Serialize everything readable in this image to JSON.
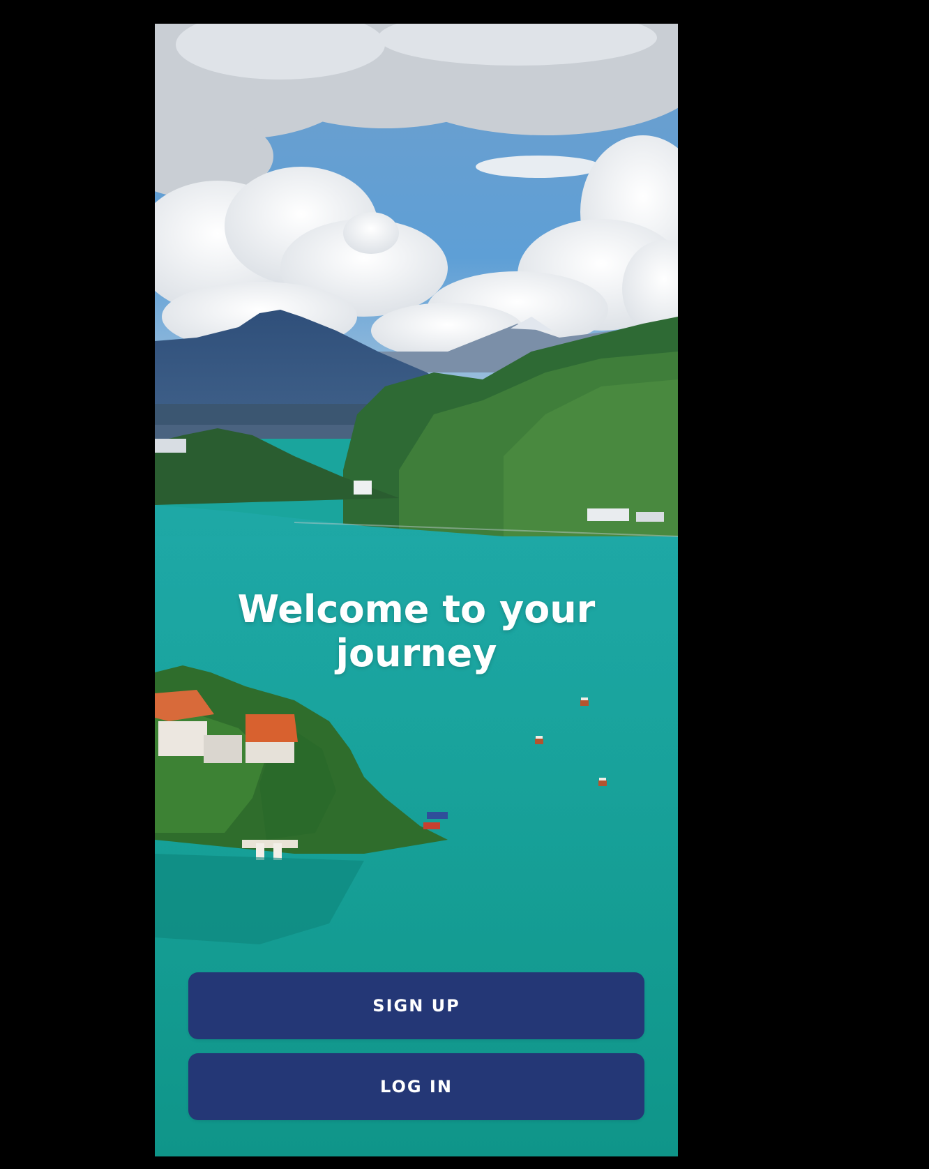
{
  "screen": {
    "title": "Welcome to your journey"
  },
  "actions": {
    "signup_label": "SIGN UP",
    "login_label": "LOG IN"
  },
  "background": {
    "icon": "lake-landscape-photo"
  },
  "colors": {
    "page_background": "#000000",
    "button": "#243776",
    "button_text": "#ffffff",
    "title_text": "#ffffff",
    "lake": "#1aa59d",
    "sky": "#5a9fd4"
  }
}
